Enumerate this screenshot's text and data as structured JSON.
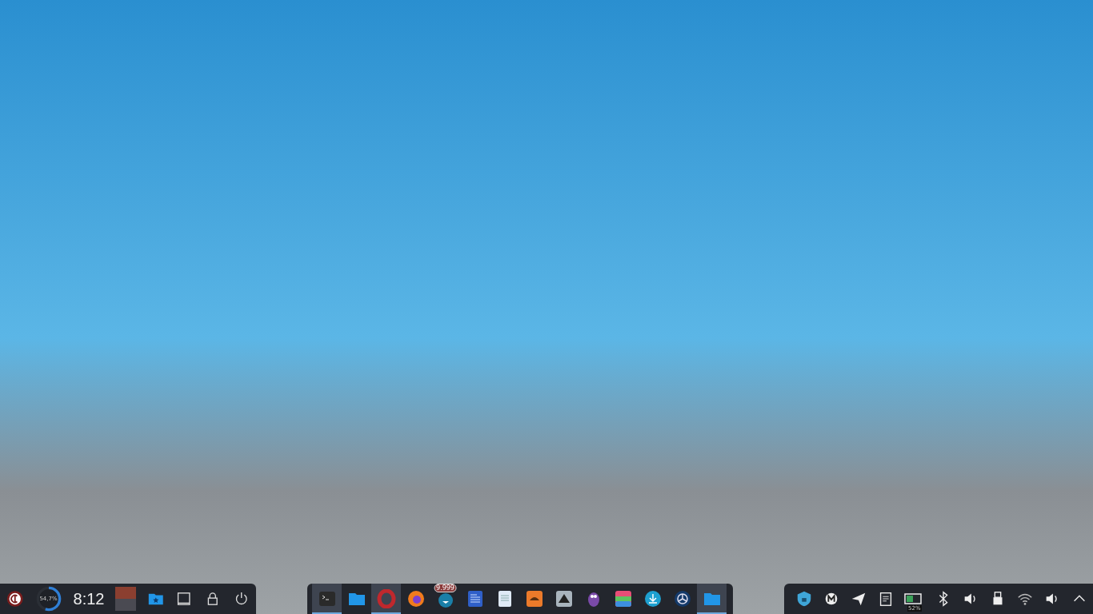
{
  "left_panel": {
    "cpu_meter": {
      "level": 0.547,
      "reading": "54,7%"
    },
    "clock": "8:12"
  },
  "tasks": [
    {
      "kind": "terminal",
      "active": true
    },
    {
      "kind": "folder",
      "active": false
    },
    {
      "kind": "ring",
      "active": true
    },
    {
      "kind": "fox",
      "active": false
    },
    {
      "kind": "chat",
      "active": false,
      "badge": "9.999"
    },
    {
      "kind": "news",
      "active": false
    },
    {
      "kind": "document",
      "active": false
    },
    {
      "kind": "paint",
      "active": false
    },
    {
      "kind": "vector",
      "active": false
    },
    {
      "kind": "creature",
      "active": false
    },
    {
      "kind": "rainbow",
      "active": false
    },
    {
      "kind": "download",
      "active": false
    },
    {
      "kind": "wheel",
      "active": false
    },
    {
      "kind": "folder",
      "active": true
    }
  ],
  "tray": {
    "battery_reading": "52%"
  }
}
